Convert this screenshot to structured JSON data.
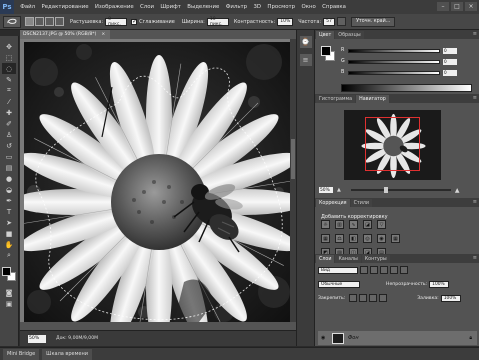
{
  "app": {
    "logo": "Ps"
  },
  "menu": [
    "Файл",
    "Редактирование",
    "Изображение",
    "Слои",
    "Шрифт",
    "Выделение",
    "Фильтр",
    "3D",
    "Просмотр",
    "Окно",
    "Справка"
  ],
  "window_controls": {
    "minimize": "–",
    "maximize": "□",
    "close": "×"
  },
  "options": {
    "feather_label": "Растушевка:",
    "feather_value": "0 пикс.",
    "antialias_label": "Сглаживание",
    "width_label": "Ширина:",
    "width_value": "10 пикс.",
    "contrast_label": "Контрастность:",
    "contrast_value": "10%",
    "frequency_label": "Частота:",
    "frequency_value": "57",
    "refine_button": "Уточн. край..."
  },
  "document": {
    "tab_title": "DSCN2137.JPG @ 50% (RGB/8*)",
    "tab_close": "×",
    "zoom": "50%",
    "doc_info": "Док: 9,00M/9,00M"
  },
  "bottom_tabs": [
    "Mini Bridge",
    "Шкала времени"
  ],
  "panels": {
    "color_tabs": [
      "Цвет",
      "Образцы"
    ],
    "sliders": [
      {
        "label": "R",
        "value": "0"
      },
      {
        "label": "G",
        "value": "0"
      },
      {
        "label": "B",
        "value": "0"
      }
    ],
    "nav_tabs": [
      "Гистограмма",
      "Навигатор"
    ],
    "nav_zoom": "50%",
    "nav_zoom_level": 0.35,
    "corr_tabs": [
      "Коррекция",
      "Стили"
    ],
    "corr_title": "Добавить корректировку",
    "layers_tabs": [
      "Слои",
      "Каналы",
      "Контуры"
    ],
    "layer_filter": "Вид",
    "blend_mode": "Обычные",
    "opacity_label": "Непрозрачность:",
    "opacity_value": "100%",
    "lock_label": "Закрепить:",
    "fill_label": "Заливка:",
    "fill_value": "100%",
    "layer_name": "Фон"
  }
}
